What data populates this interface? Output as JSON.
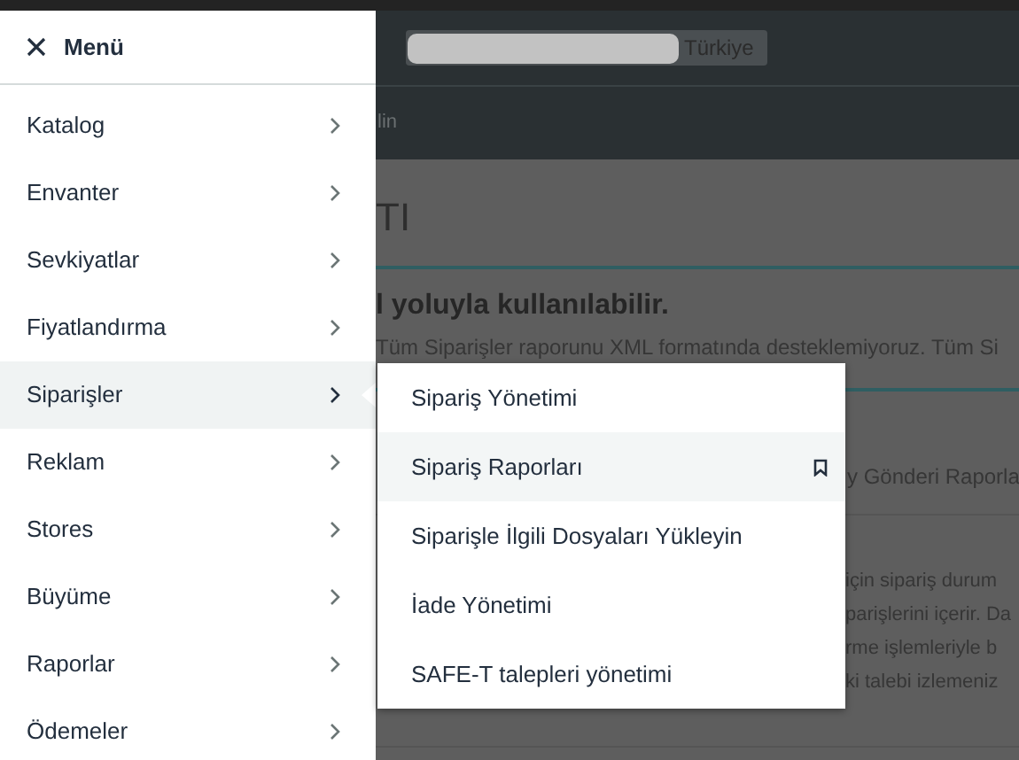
{
  "menu": {
    "title": "Menü",
    "items": [
      {
        "label": "Katalog",
        "selected": false
      },
      {
        "label": "Envanter",
        "selected": false
      },
      {
        "label": "Sevkiyatlar",
        "selected": false
      },
      {
        "label": "Fiyatlandırma",
        "selected": false
      },
      {
        "label": "Siparişler",
        "selected": true
      },
      {
        "label": "Reklam",
        "selected": false
      },
      {
        "label": "Stores",
        "selected": false
      },
      {
        "label": "Büyüme",
        "selected": false
      },
      {
        "label": "Raporlar",
        "selected": false
      },
      {
        "label": "Ödemeler",
        "selected": false
      }
    ]
  },
  "submenu": {
    "items": [
      {
        "label": "Sipariş Yönetimi",
        "selected": false
      },
      {
        "label": "Sipariş Raporları",
        "selected": true
      },
      {
        "label": "Siparişle İlgili Dosyaları Yükleyin",
        "selected": false
      },
      {
        "label": "İade Yönetimi",
        "selected": false
      },
      {
        "label": "SAFE-T talepleri yönetimi",
        "selected": false
      }
    ]
  },
  "background": {
    "region": "Türkiye",
    "nav_text": "lin",
    "heading": "TI",
    "notice_title": "l yoluyla kullanılabilir.",
    "notice_text": "Tüm Siparişler raporunu XML formatında desteklemiyoruz. Tüm Si",
    "section_title": "y Gönderi Raporla",
    "paragraph_lines": [
      "için sipariş durum",
      "parişlerini içerir. Da",
      "rme işlemleriyle b",
      "ki talebi izlemeniz"
    ]
  }
}
